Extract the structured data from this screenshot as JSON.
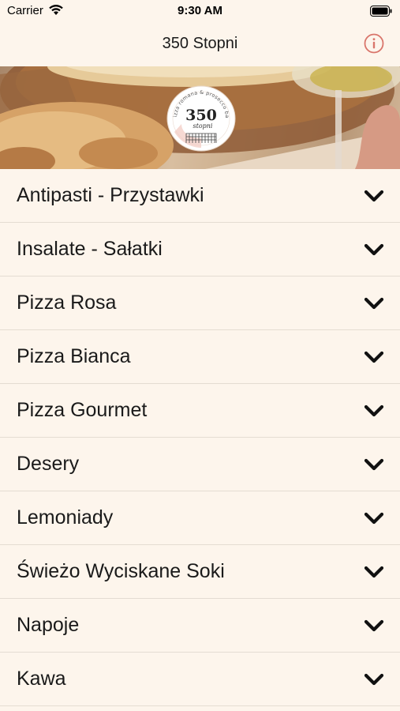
{
  "status_bar": {
    "carrier": "Carrier",
    "time": "9:30 AM",
    "icons": [
      "wifi-icon",
      "battery-icon"
    ]
  },
  "nav": {
    "title": "350 Stopni",
    "info_icon": "info-circle-icon",
    "accent_color": "#d9756b"
  },
  "logo": {
    "number": "350",
    "script_text": "stopni",
    "ring_text": "pizza romana & prosecco bar"
  },
  "menu": {
    "categories": [
      {
        "label": "Antipasti - Przystawki"
      },
      {
        "label": "Insalate - Sałatki"
      },
      {
        "label": "Pizza Rosa"
      },
      {
        "label": "Pizza Bianca"
      },
      {
        "label": "Pizza Gourmet"
      },
      {
        "label": "Desery"
      },
      {
        "label": "Lemoniady"
      },
      {
        "label": "Świeżo Wyciskane Soki"
      },
      {
        "label": "Napoje"
      },
      {
        "label": "Kawa"
      }
    ],
    "chevron_icon": "chevron-down-icon"
  },
  "colors": {
    "background": "#fdf5ec",
    "divider": "#e4dcd2",
    "text": "#1a1a1a"
  }
}
